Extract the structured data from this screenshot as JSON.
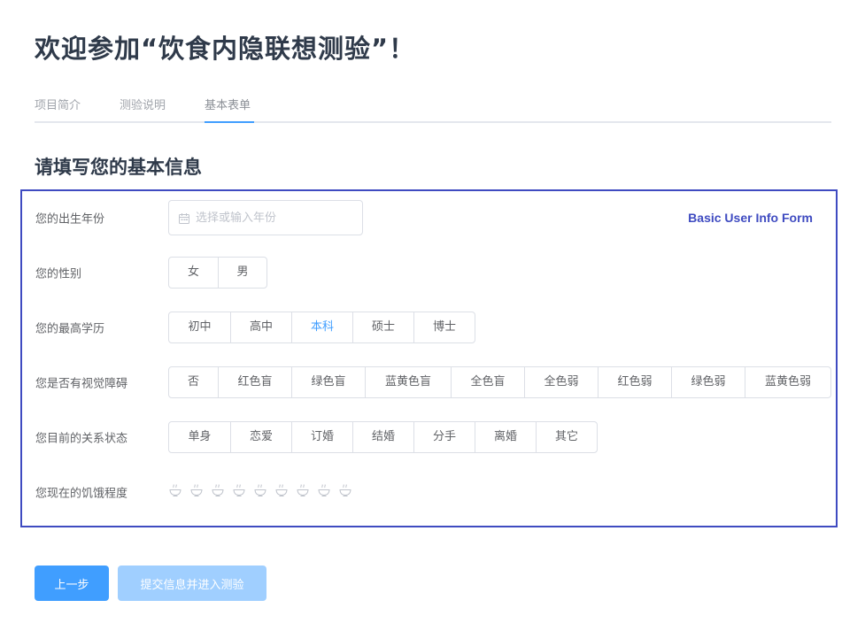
{
  "page": {
    "title": "欢迎参加“饮食内隐联想测验”！"
  },
  "tabs": [
    {
      "label": "项目简介",
      "active": false
    },
    {
      "label": "测验说明",
      "active": false
    },
    {
      "label": "基本表单",
      "active": true
    }
  ],
  "section_title": "请填写您的基本信息",
  "form": {
    "annotation": "Basic User Info Form",
    "birth_year": {
      "label": "您的出生年份",
      "placeholder": "选择或输入年份",
      "value": "",
      "icon": "calendar-icon"
    },
    "gender": {
      "label": "您的性别",
      "options": [
        "女",
        "男"
      ],
      "selected": null
    },
    "education": {
      "label": "您的最高学历",
      "options": [
        "初中",
        "高中",
        "本科",
        "硕士",
        "博士"
      ],
      "selected": "本科"
    },
    "color_vision": {
      "label": "您是否有视觉障碍",
      "options": [
        "否",
        "红色盲",
        "绿色盲",
        "蓝黄色盲",
        "全色盲",
        "全色弱",
        "红色弱",
        "绿色弱",
        "蓝黄色弱"
      ],
      "selected": null
    },
    "relationship": {
      "label": "您目前的关系状态",
      "options": [
        "单身",
        "恋爱",
        "订婚",
        "结婚",
        "分手",
        "离婚",
        "其它"
      ],
      "selected": null
    },
    "hunger": {
      "label": "您现在的饥饿程度",
      "max": 9,
      "value": 0,
      "icon": "bowl-icon"
    }
  },
  "actions": {
    "prev_label": "上一步",
    "submit_label": "提交信息并进入测验",
    "submit_disabled": true
  },
  "colors": {
    "primary": "#409eff",
    "primary_disabled": "#a0cfff",
    "annotation_border": "#3f4bc1",
    "title": "#2f3a4a"
  }
}
